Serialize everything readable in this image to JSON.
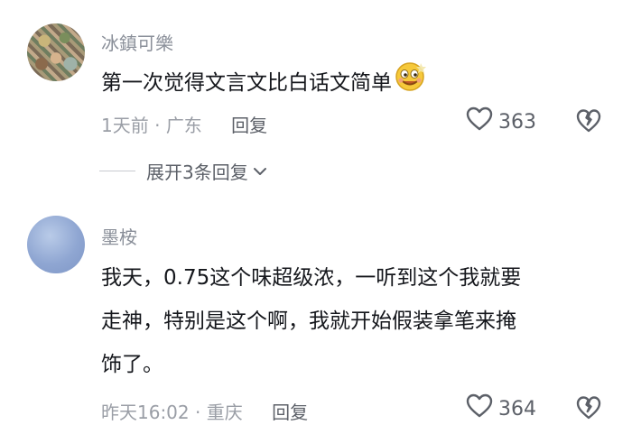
{
  "comments": [
    {
      "username": "冰鎮可樂",
      "text": "第一次觉得文言文比白话文简单",
      "time": "1天前",
      "location": "广东",
      "reply_label": "回复",
      "likes": "363",
      "emoji_icon": "smiling-face-emoji"
    },
    {
      "username": "墨桉",
      "text_lines": [
        "我天，0.75这个味超级浓，一听到这个我就要",
        "走神，特别是这个啊，我就开始假装拿笔来掩",
        "饰了。"
      ],
      "time": "昨天16:02",
      "location": "重庆",
      "reply_label": "回复",
      "likes": "364"
    }
  ],
  "expand_replies": {
    "label": "展开3条回复"
  },
  "meta_separator": "·",
  "colors": {
    "primary_text": "#15171c",
    "secondary_text": "#8a8f99",
    "icon": "#5c6068"
  }
}
